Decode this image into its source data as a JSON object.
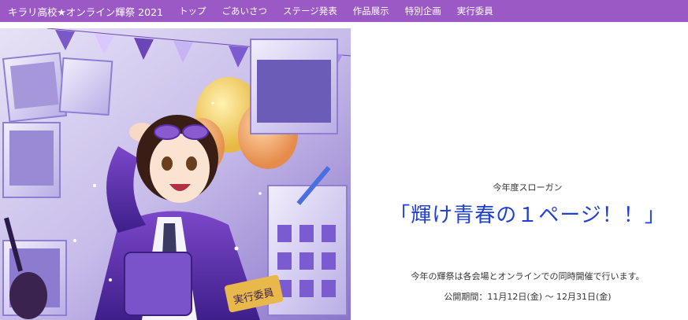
{
  "nav": {
    "brand": "キラリ高校★オンライン輝祭 2021",
    "items": [
      {
        "label": "トップ"
      },
      {
        "label": "ごあいさつ"
      },
      {
        "label": "ステージ発表"
      },
      {
        "label": "作品展示"
      },
      {
        "label": "特別企画"
      },
      {
        "label": "実行委員"
      }
    ]
  },
  "hero": {
    "armband_text": "実行委員"
  },
  "main": {
    "slogan_label": "今年度スローガン",
    "slogan": "「輝け青春の１ページ！！」",
    "description": "今年の輝祭は各会場とオンラインでの同時開催で行います。",
    "period": "公開期間：11月12日(金) 〜 12月31日(金)"
  },
  "colors": {
    "nav_bg": "#9b59c6",
    "slogan": "#1f3fd6"
  }
}
